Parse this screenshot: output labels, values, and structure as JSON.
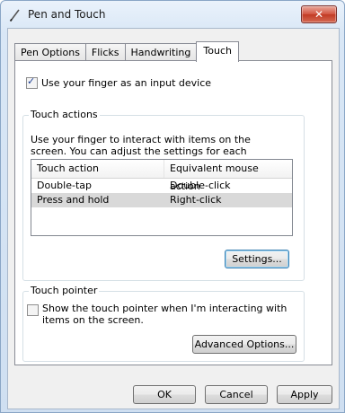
{
  "window": {
    "title": "Pen and Touch",
    "close_label": "✕"
  },
  "tabs": [
    {
      "label": "Pen Options"
    },
    {
      "label": "Flicks"
    },
    {
      "label": "Handwriting"
    },
    {
      "label": "Touch",
      "active": true
    }
  ],
  "touch": {
    "use_finger_label": "Use your finger as an input device",
    "use_finger_checked": true,
    "actions_group_title": "Touch actions",
    "actions_description": "Use your finger to interact with items on the screen. You can adjust the settings for each touch action.",
    "table": {
      "headers": [
        "Touch action",
        "Equivalent mouse action"
      ],
      "rows": [
        [
          "Double-tap",
          "Double-click"
        ],
        [
          "Press and hold",
          "Right-click"
        ]
      ],
      "selected_row": 1
    },
    "settings_button": "Settings...",
    "pointer_group_title": "Touch pointer",
    "show_pointer_label": "Show the touch pointer when I'm interacting with items on the screen.",
    "show_pointer_checked": false,
    "advanced_button": "Advanced Options..."
  },
  "footer": {
    "ok": "OK",
    "cancel": "Cancel",
    "apply": "Apply"
  },
  "icons": [
    "pen-icon",
    "close-icon",
    "checkbox-checked-icon",
    "checkbox-unchecked-icon"
  ],
  "colors": {
    "title_bar": "#d9e7f6",
    "close_button": "#c13a24",
    "dialog_bg": "#f0f0f0",
    "selected_row": "#d9d9d9"
  }
}
